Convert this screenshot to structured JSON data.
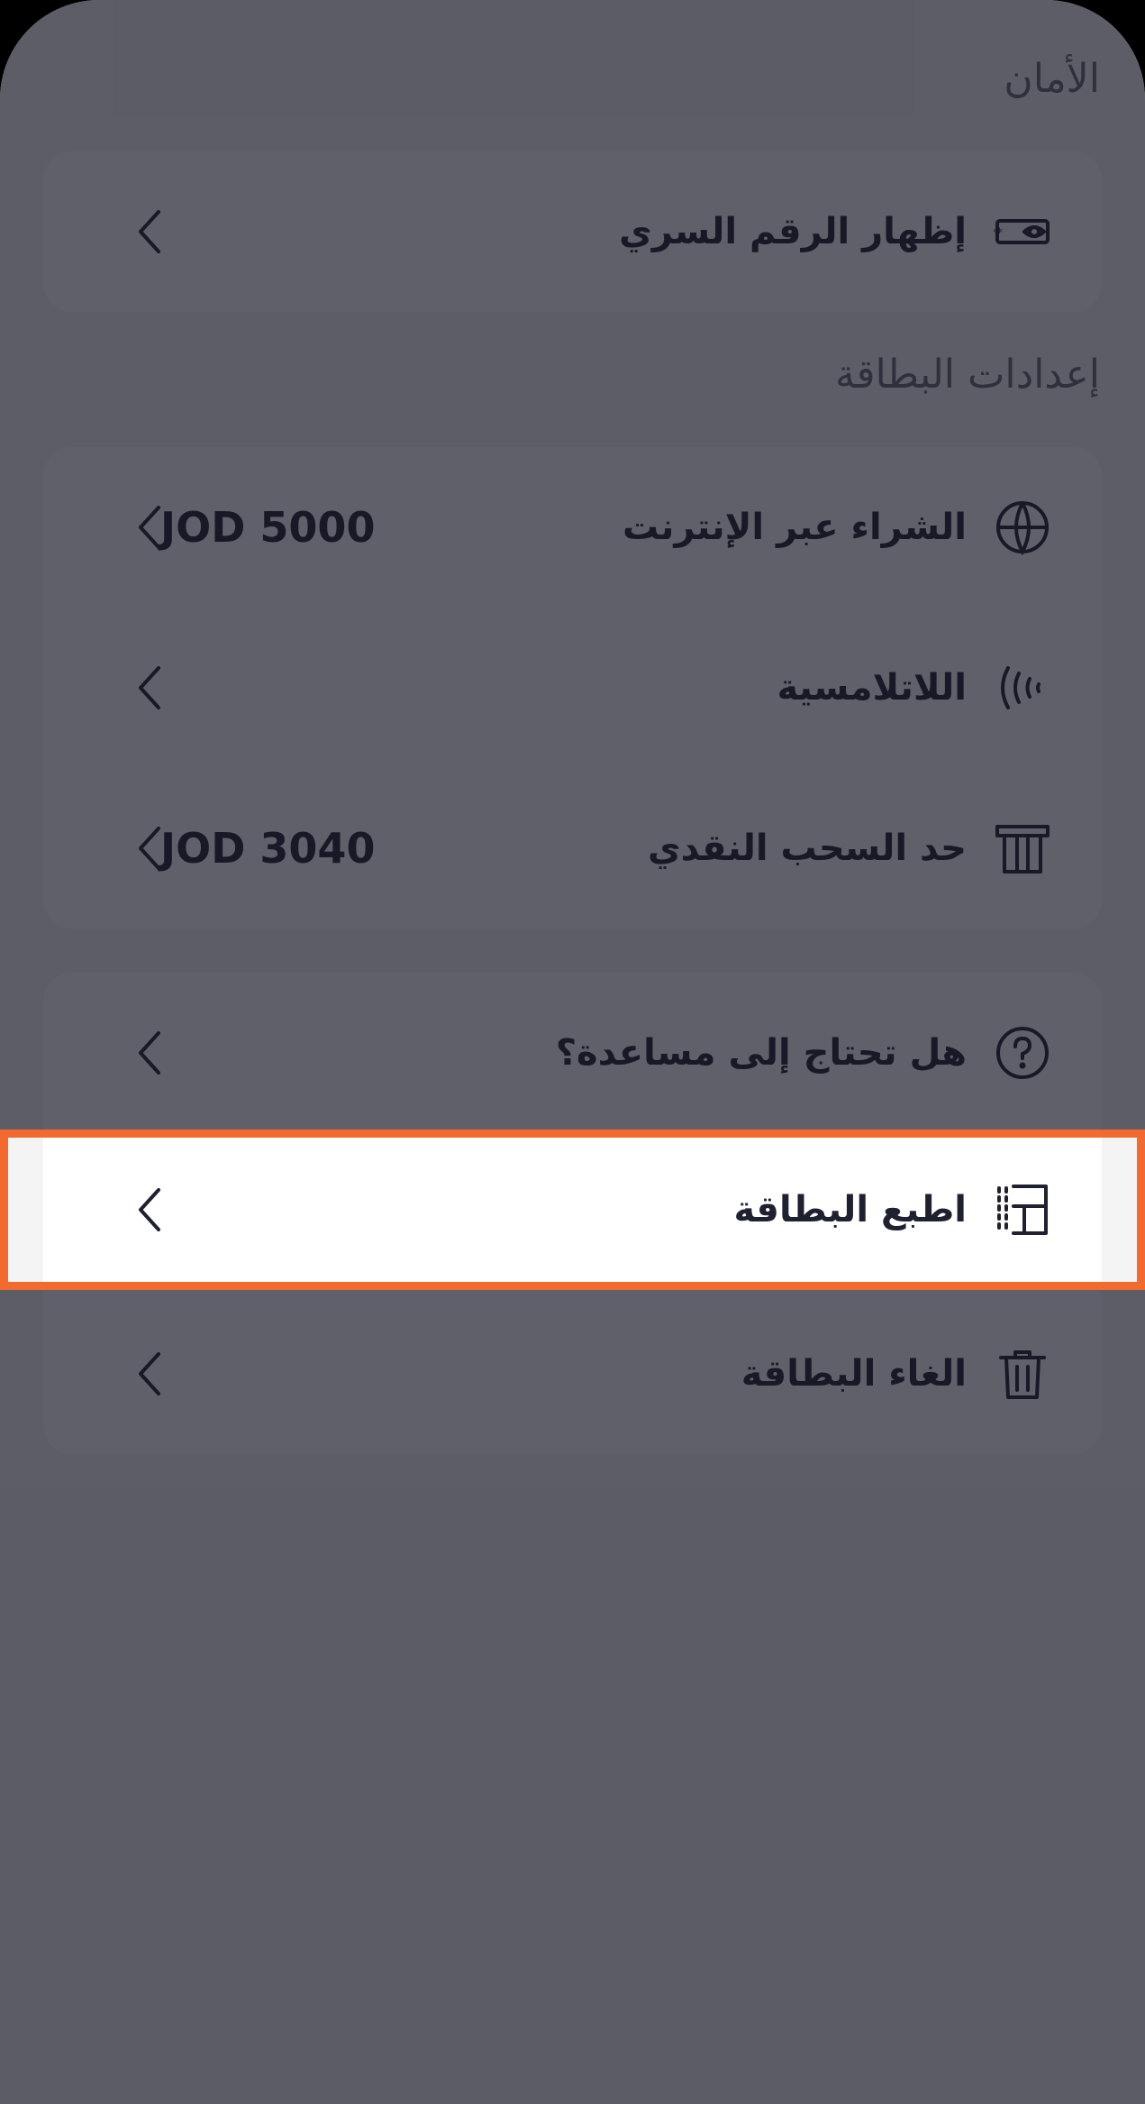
{
  "sections": {
    "security_title": "الأمان",
    "card_settings_title": "إعدادات البطاقة"
  },
  "security": {
    "show_pin": {
      "label": "إظهار الرقم السري",
      "icon": "pin-eye-icon"
    }
  },
  "settings": {
    "online_purchase": {
      "label": "الشراء عبر الإنترنت",
      "value": "JOD 5000",
      "icon": "globe-icon"
    },
    "contactless": {
      "label": "اللاتلامسية",
      "icon": "contactless-icon"
    },
    "cash_withdrawal": {
      "label": "حد السحب النقدي",
      "value": "JOD 3040",
      "icon": "atm-icon"
    }
  },
  "actions": {
    "help": {
      "label": "هل تحتاج إلى مساعدة؟",
      "icon": "question-icon"
    },
    "print_card": {
      "label": "اطبع البطاقة",
      "icon": "print-card-icon"
    },
    "cancel_card": {
      "label": "الغاء البطاقة",
      "icon": "trash-icon"
    }
  },
  "colors": {
    "highlight_border": "#f26a2e",
    "text": "#1f2030",
    "overlay": "rgba(20,20,35,0.68)"
  }
}
